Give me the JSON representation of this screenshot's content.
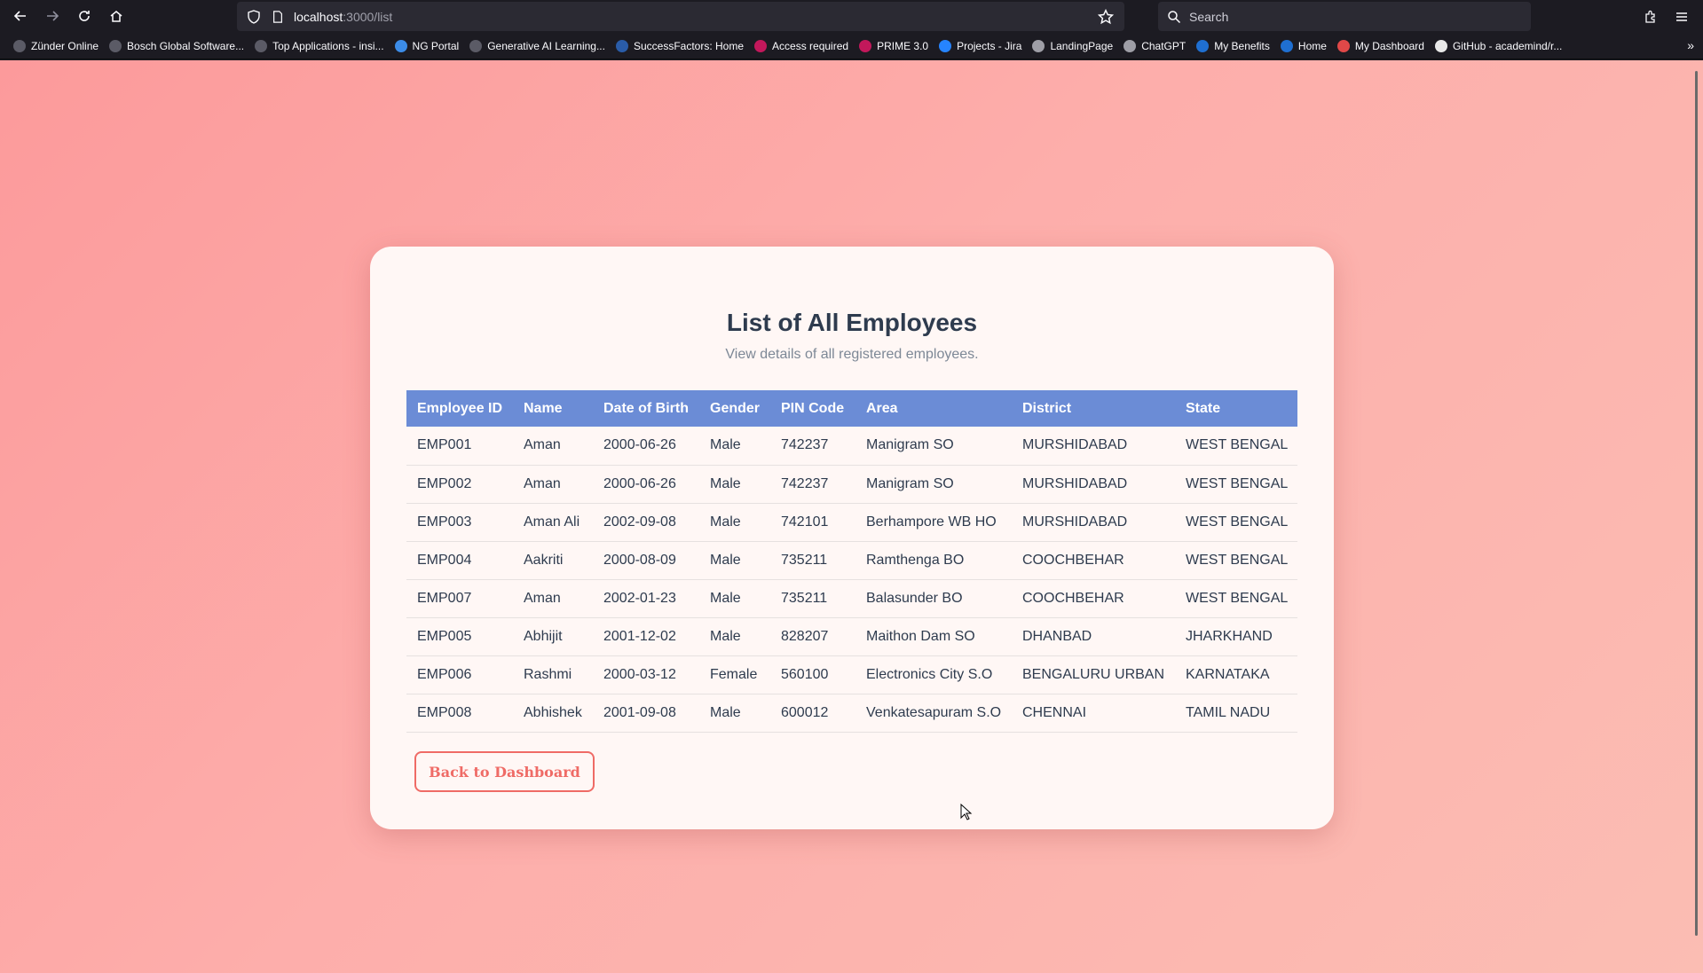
{
  "browser": {
    "url_host": "localhost",
    "url_rest": ":3000/list",
    "search_placeholder": "Search",
    "bookmarks": [
      {
        "label": "Zünder Online",
        "color": "#5b5b66"
      },
      {
        "label": "Bosch Global Software...",
        "color": "#5b5b66"
      },
      {
        "label": "Top Applications - insi...",
        "color": "#5b5b66"
      },
      {
        "label": "NG Portal",
        "color": "#3c8ce7"
      },
      {
        "label": "Generative AI Learning...",
        "color": "#5b5b66"
      },
      {
        "label": "SuccessFactors: Home",
        "color": "#2a5ca8"
      },
      {
        "label": "Access required",
        "color": "#c2185b"
      },
      {
        "label": "PRIME 3.0",
        "color": "#c2185b"
      },
      {
        "label": "Projects - Jira",
        "color": "#2684ff"
      },
      {
        "label": "LandingPage",
        "color": "#9e9ea6"
      },
      {
        "label": "ChatGPT",
        "color": "#9e9ea6"
      },
      {
        "label": "My Benefits",
        "color": "#1f6fd1"
      },
      {
        "label": "Home",
        "color": "#1f6fd1"
      },
      {
        "label": "My Dashboard",
        "color": "#e04848"
      },
      {
        "label": "GitHub - academind/r...",
        "color": "#e8e8e8"
      }
    ]
  },
  "page": {
    "title": "List of All Employees",
    "subtitle": "View details of all registered employees.",
    "back_button": "Back to Dashboard"
  },
  "table": {
    "headers": [
      "Employee ID",
      "Name",
      "Date of Birth",
      "Gender",
      "PIN Code",
      "Area",
      "District",
      "State"
    ],
    "rows": [
      [
        "EMP001",
        "Aman",
        "2000-06-26",
        "Male",
        "742237",
        "Manigram SO",
        "MURSHIDABAD",
        "WEST BENGAL"
      ],
      [
        "EMP002",
        "Aman",
        "2000-06-26",
        "Male",
        "742237",
        "Manigram SO",
        "MURSHIDABAD",
        "WEST BENGAL"
      ],
      [
        "EMP003",
        "Aman Ali",
        "2002-09-08",
        "Male",
        "742101",
        "Berhampore WB HO",
        "MURSHIDABAD",
        "WEST BENGAL"
      ],
      [
        "EMP004",
        "Aakriti",
        "2000-08-09",
        "Male",
        "735211",
        "Ramthenga BO",
        "COOCHBEHAR",
        "WEST BENGAL"
      ],
      [
        "EMP007",
        "Aman",
        "2002-01-23",
        "Male",
        "735211",
        "Balasunder BO",
        "COOCHBEHAR",
        "WEST BENGAL"
      ],
      [
        "EMP005",
        "Abhijit",
        "2001-12-02",
        "Male",
        "828207",
        "Maithon Dam SO",
        "DHANBAD",
        "JHARKHAND"
      ],
      [
        "EMP006",
        "Rashmi",
        "2000-03-12",
        "Female",
        "560100",
        "Electronics City S.O",
        "BENGALURU URBAN",
        "KARNATAKA"
      ],
      [
        "EMP008",
        "Abhishek",
        "2001-09-08",
        "Male",
        "600012",
        "Venkatesapuram S.O",
        "CHENNAI",
        "TAMIL NADU"
      ]
    ]
  },
  "colors": {
    "header_bg": "#6b8cd6",
    "accent": "#ef6b66",
    "text": "#2e3b4e"
  }
}
